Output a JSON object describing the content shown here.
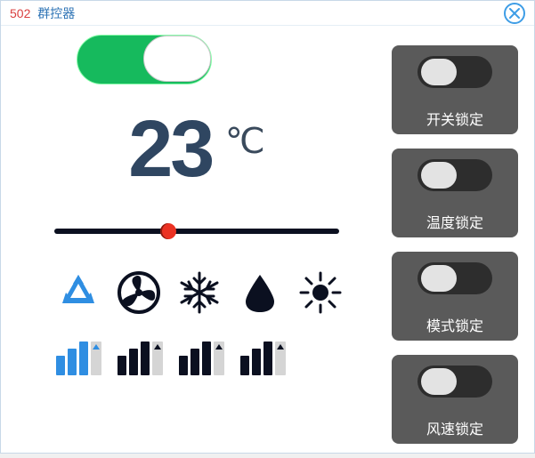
{
  "title": {
    "id": "502",
    "name": "群控器"
  },
  "power": {
    "on": true
  },
  "temperature": {
    "value": "23",
    "unit": "℃",
    "slider_percent": 40
  },
  "modes": [
    "cycle",
    "fan",
    "cool",
    "dry",
    "heat"
  ],
  "fan_speeds": [
    "1",
    "2",
    "3",
    "auto"
  ],
  "fan_active_index": 0,
  "locks": {
    "power": {
      "label": "开关锁定",
      "on": false
    },
    "temp": {
      "label": "温度锁定",
      "on": false
    },
    "mode": {
      "label": "模式锁定",
      "on": false
    },
    "fan": {
      "label": "风速锁定",
      "on": false
    }
  }
}
